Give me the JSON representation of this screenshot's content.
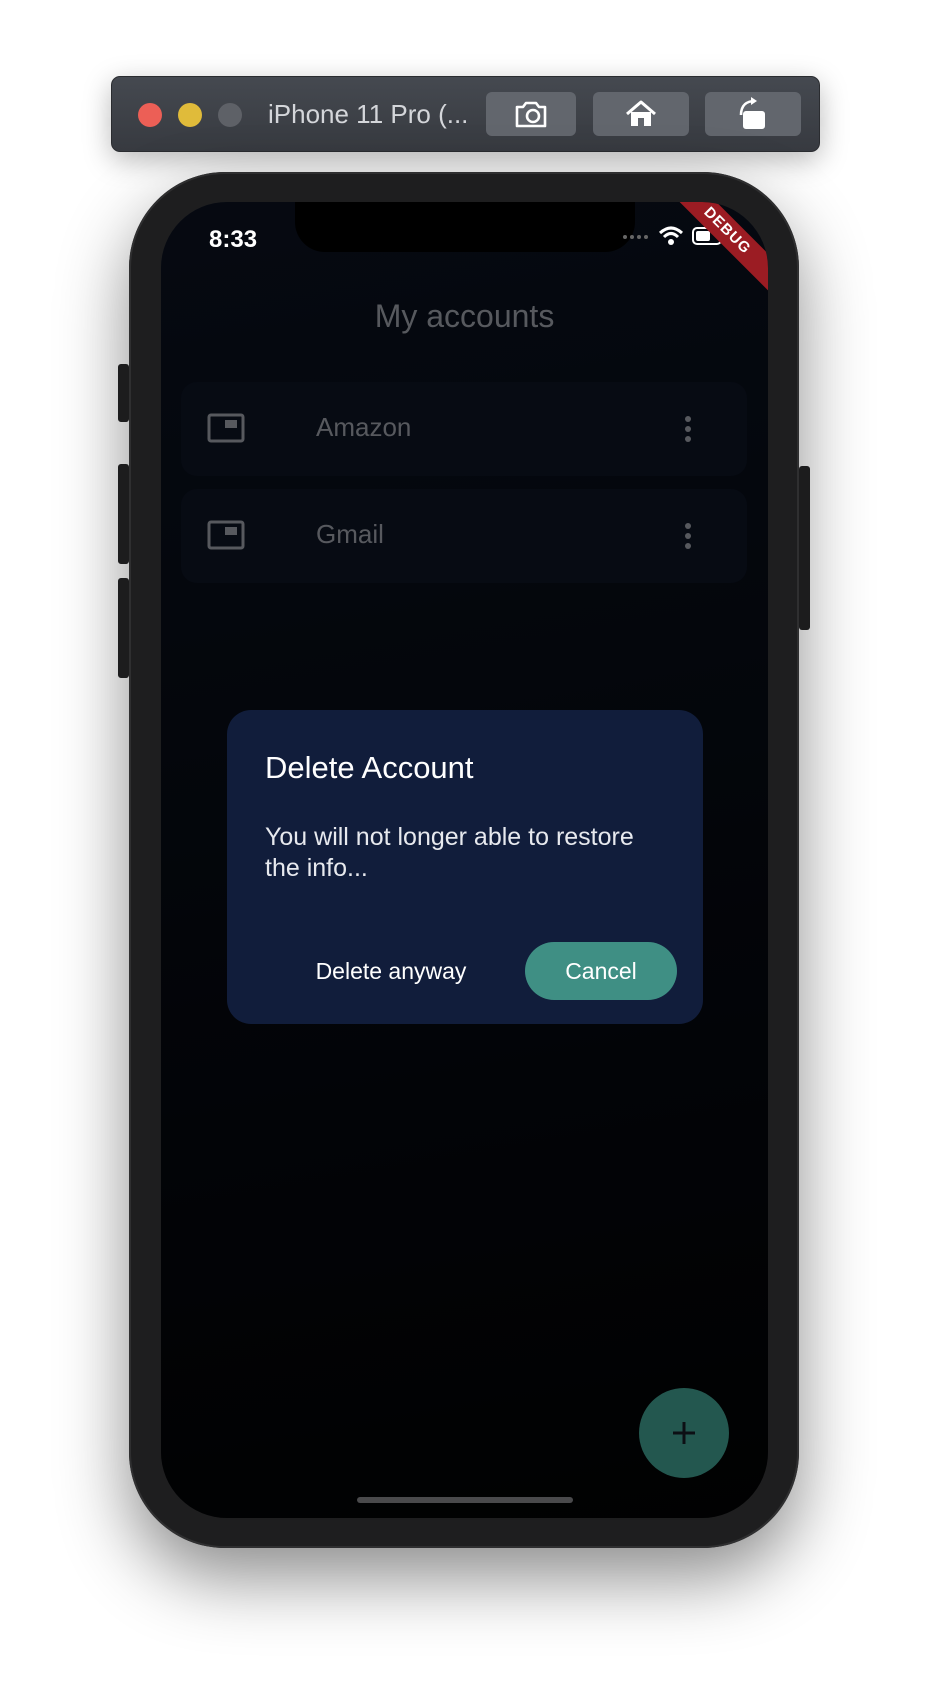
{
  "simulator": {
    "title": "iPhone 11 Pro (...",
    "buttons": [
      "screenshot-icon",
      "home-icon",
      "rotate-icon"
    ]
  },
  "status_bar": {
    "time": "8:33",
    "debug_banner": "DEBUG"
  },
  "app": {
    "title": "My accounts",
    "accounts": [
      {
        "name": "Amazon",
        "icon": "account-card-icon"
      },
      {
        "name": "Gmail",
        "icon": "account-card-icon"
      }
    ]
  },
  "dialog": {
    "title": "Delete Account",
    "message": "You will not longer able to restore the info...",
    "delete_label": "Delete anyway",
    "cancel_label": "Cancel"
  },
  "fab": {
    "label": "+"
  },
  "colors": {
    "accent": "#3f8f84",
    "dialog_bg": "#111d3b",
    "debug_banner": "#9b1c23"
  }
}
